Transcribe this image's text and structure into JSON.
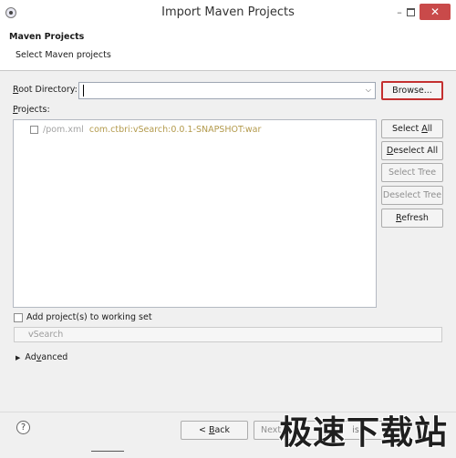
{
  "window": {
    "title": "Import Maven Projects",
    "close_glyph": "✕",
    "minimize_glyph": "–",
    "close_color": "#c94a4a"
  },
  "banner": {
    "title": "Maven Projects",
    "description": "Select Maven projects"
  },
  "root_directory": {
    "label_mnemonic": "R",
    "label_rest": "oot Directory:",
    "value": "",
    "browse_label": "Browse..."
  },
  "projects": {
    "label_mnemonic": "P",
    "label_rest": "rojects:",
    "items": [
      {
        "path": "/pom.xml",
        "artifact": "com.ctbri:vSearch:0.0.1-SNAPSHOT:war",
        "checked": false
      }
    ]
  },
  "side_buttons": {
    "select_all": {
      "pre": "Select ",
      "mnemonic": "A",
      "post": "ll"
    },
    "deselect_all": {
      "pre": "",
      "mnemonic": "D",
      "post": "eselect All"
    },
    "select_tree": "Select Tree",
    "deselect_tree": "Deselect Tree",
    "refresh": {
      "pre": "",
      "mnemonic": "R",
      "post": "efresh"
    }
  },
  "working_set": {
    "label": "Add project(s) to working set",
    "value": "vSearch"
  },
  "advanced": {
    "pre": "Ad",
    "mnemonic": "v",
    "post": "anced"
  },
  "footer": {
    "help_glyph": "?",
    "back": {
      "prefix": "< ",
      "mnemonic": "B",
      "rest": "ack"
    },
    "next_partial": "Next",
    "finish_partial": "ish",
    "watermark": "极速下载站"
  }
}
